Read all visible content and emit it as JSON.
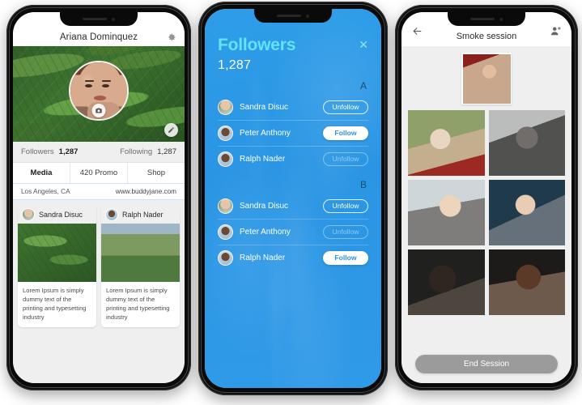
{
  "background_color": "#ffffff",
  "phones": {
    "profile": {
      "header": {
        "title": "Ariana Dominquez",
        "settings_icon": "gear-icon"
      },
      "cover": {
        "edit_icon": "pencil-icon",
        "avatar_camera_icon": "camera-icon"
      },
      "stats": {
        "followers_label": "Followers",
        "followers_value": "1,287",
        "following_label": "Following",
        "following_value": "1,287"
      },
      "tabs": [
        {
          "label": "Media",
          "active": true
        },
        {
          "label": "420 Promo",
          "active": false
        },
        {
          "label": "Shop",
          "active": false
        }
      ],
      "meta": {
        "location": "Los Angeles, CA",
        "website": "www.buddyjane.com"
      },
      "posts": [
        {
          "author": "Sandra Disuc",
          "text": "Lorem Ipsum is simply dummy text of the printing and typesetting industry"
        },
        {
          "author": "Ralph Nader",
          "text": "Lorem Ipsum is simply dummy text of the printing and typesetting industry"
        }
      ]
    },
    "followers": {
      "title": "Followers",
      "count": "1,287",
      "close_icon": "close-icon",
      "accent_color": "#63e2fb",
      "background_color": "#2d9ae7",
      "sections": [
        {
          "label": "A",
          "rows": [
            {
              "name": "Sandra Disuc",
              "action": "Unfollow",
              "style": "outline"
            },
            {
              "name": "Peter Anthony",
              "action": "Follow",
              "style": "solid"
            },
            {
              "name": "Ralph Nader",
              "action": "Unfollow",
              "style": "outline-dim"
            }
          ]
        },
        {
          "label": "B",
          "rows": [
            {
              "name": "Sandra Disuc",
              "action": "Unfollow",
              "style": "outline"
            },
            {
              "name": "Peter Anthony",
              "action": "Unfollow",
              "style": "outline-dim"
            },
            {
              "name": "Ralph Nader",
              "action": "Follow",
              "style": "solid"
            }
          ]
        }
      ]
    },
    "smoke_session": {
      "header": {
        "back_icon": "back-arrow-icon",
        "title": "Smoke session",
        "add_person_icon": "add-person-icon"
      },
      "featured_photo": "woman-smoking-portrait",
      "grid_photos": [
        "woman-vaping-green-background",
        "man-smoking-black-and-white",
        "blonde-woman-exhaling-smoke",
        "woman-white-hair-smoking",
        "bearded-man-profile-smoking",
        "man-profile-exhaling-smoke"
      ],
      "end_button": "End Session"
    }
  }
}
